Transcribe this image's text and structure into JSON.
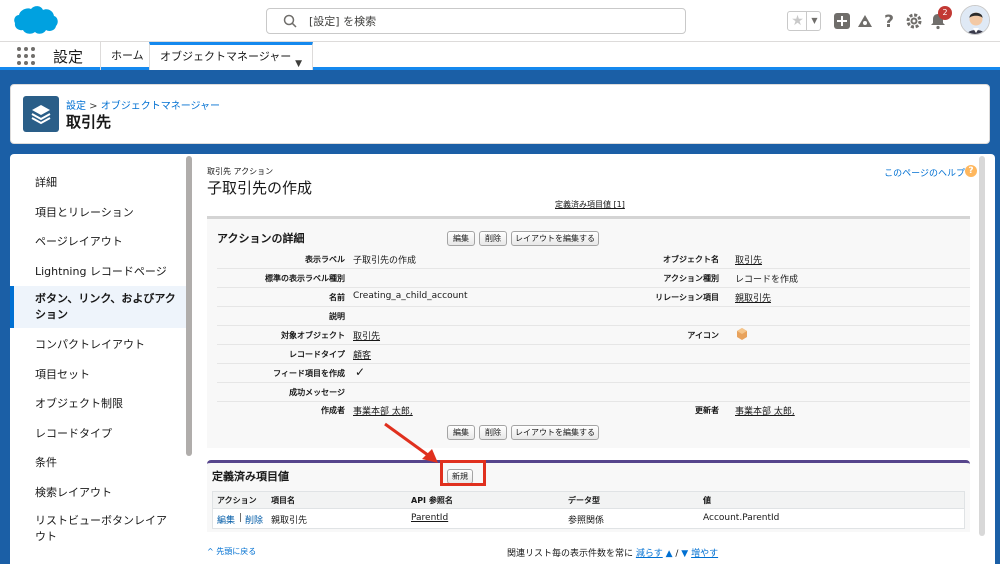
{
  "header": {
    "search_placeholder": "[設定] を検索",
    "notification_count": "2",
    "icons": [
      "cloud-logo",
      "search-icon",
      "star-icon",
      "chevron-down-icon",
      "plus-icon",
      "trailhead-icon",
      "help-icon",
      "gear-icon",
      "bell-icon",
      "avatar"
    ]
  },
  "context_bar": {
    "app_name": "設定",
    "tabs": [
      {
        "label": "ホーム"
      },
      {
        "label": "オブジェクトマネージャー"
      }
    ]
  },
  "page_header": {
    "breadcrumb_root": "設定",
    "breadcrumb_sep": " > ",
    "breadcrumb_child": "オブジェクトマネージャー",
    "title": "取引先"
  },
  "sidebar": {
    "items": [
      {
        "label": "詳細"
      },
      {
        "label": "項目とリレーション"
      },
      {
        "label": "ページレイアウト"
      },
      {
        "label": "Lightning レコードページ"
      },
      {
        "label": "ボタン、リンク、およびアクション"
      },
      {
        "label": "コンパクトレイアウト"
      },
      {
        "label": "項目セット"
      },
      {
        "label": "オブジェクト制限"
      },
      {
        "label": "レコードタイプ"
      },
      {
        "label": "条件"
      },
      {
        "label": "検索レイアウト"
      },
      {
        "label": "リストビューボタンレイアウト"
      }
    ]
  },
  "content": {
    "subtitle": "取引先 アクション",
    "title": "子取引先の作成",
    "help_link": "このページのヘルプ",
    "defined_values_link": "定義済み項目値 [1]",
    "details": {
      "section_title": "アクションの詳細",
      "buttons": {
        "edit": "編集",
        "delete": "削除",
        "edit_layout": "レイアウトを編集する"
      },
      "left_fields": [
        {
          "label": "表示ラベル",
          "value": "子取引先の作成",
          "link": false
        },
        {
          "label": "標準の表示ラベル種別",
          "value": "",
          "link": false
        },
        {
          "label": "名前",
          "value": "Creating_a_child_account",
          "link": false
        },
        {
          "label": "説明",
          "value": "",
          "link": false
        },
        {
          "label": "対象オブジェクト",
          "value": "取引先",
          "link": true
        },
        {
          "label": "レコードタイプ",
          "value": "顧客",
          "link": true
        },
        {
          "label": "フィード項目を作成",
          "value": "✓",
          "link": false
        },
        {
          "label": "成功メッセージ",
          "value": "",
          "link": false
        },
        {
          "label": "作成者",
          "value": "事業本部 太郎,",
          "link": true
        }
      ],
      "right_fields": [
        {
          "label": "オブジェクト名",
          "value": "取引先",
          "link": true
        },
        {
          "label": "アクション種別",
          "value": "レコードを作成",
          "link": false
        },
        {
          "label": "リレーション項目",
          "value": "親取引先",
          "link": true
        },
        {
          "label": "",
          "value": "",
          "link": false
        },
        {
          "label": "アイコン",
          "value": "",
          "link": false
        },
        {
          "label": "",
          "value": "",
          "link": false
        },
        {
          "label": "",
          "value": "",
          "link": false
        },
        {
          "label": "",
          "value": "",
          "link": false
        },
        {
          "label": "更新者",
          "value": "事業本部 太郎,",
          "link": true
        }
      ]
    },
    "related": {
      "section_title": "定義済み項目値",
      "new_button": "新規",
      "columns": [
        "アクション",
        "項目名",
        "API 参照名",
        "データ型",
        "値"
      ],
      "rows": [
        {
          "edit": "編集",
          "sep": "|",
          "delete": "削除",
          "field": "親取引先",
          "api": "ParentId",
          "type": "参照関係",
          "value": "Account.ParentId"
        }
      ]
    },
    "footer": {
      "back_to_top": "先頭に戻る",
      "list_text": "関連リスト毎の表示件数を常に",
      "fewer": "減らす",
      "slash": " / ",
      "more": "増やす"
    }
  },
  "colors": {
    "brand_blue": "#1b5fa6",
    "link": "#0070d2",
    "highlight": "#e0301e"
  }
}
